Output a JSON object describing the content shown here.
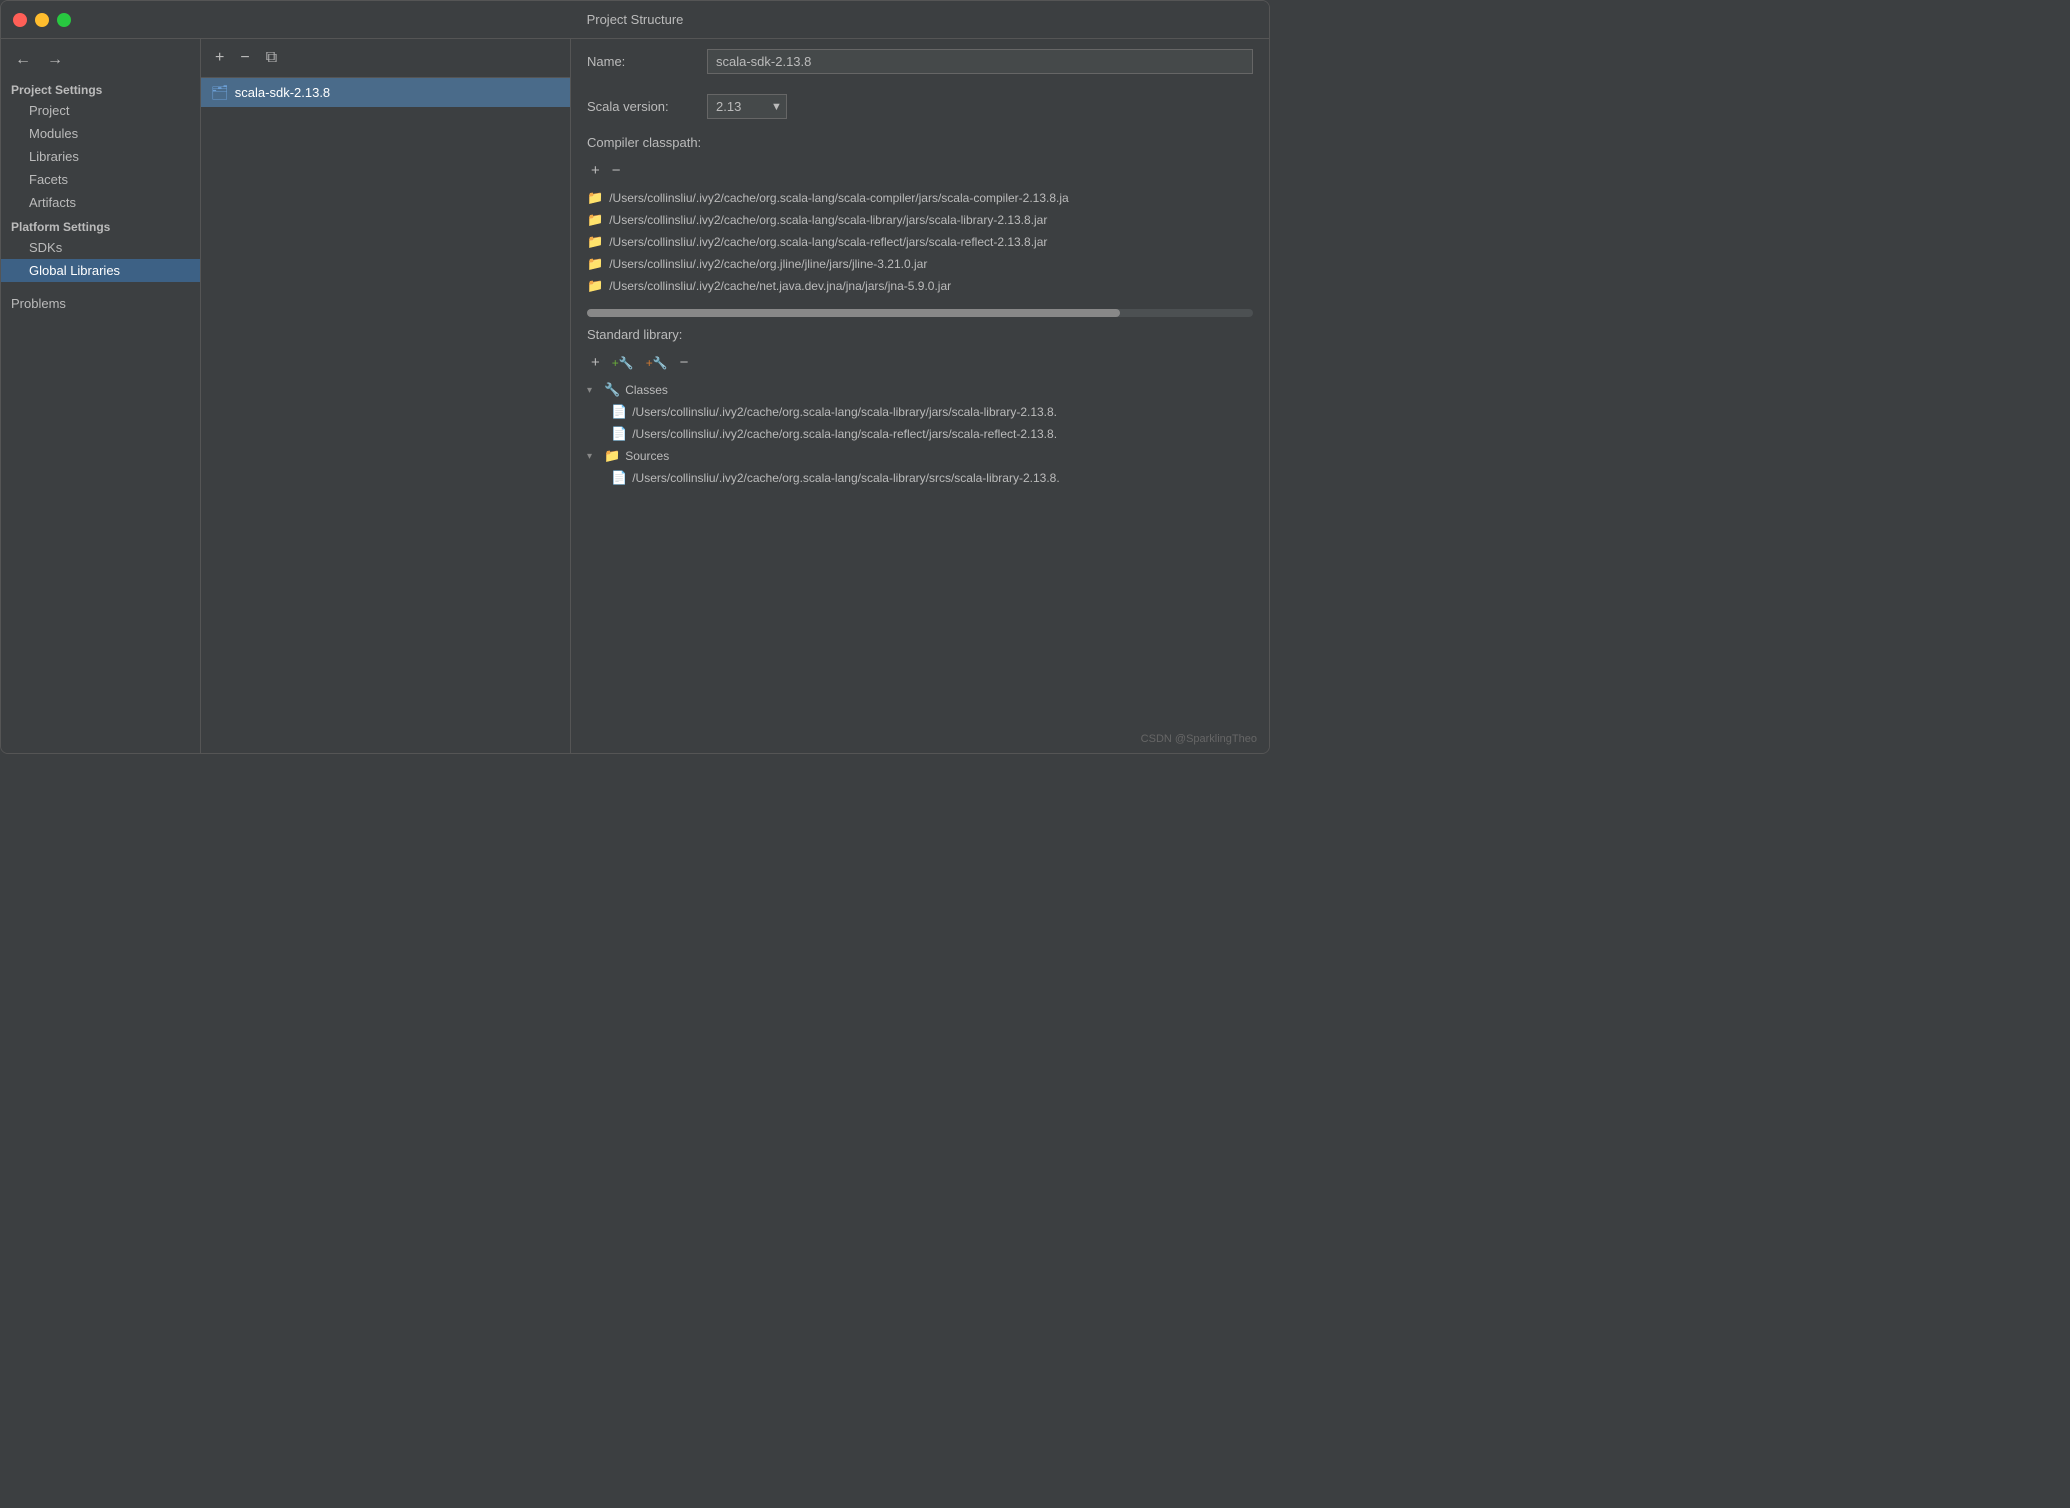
{
  "window": {
    "title": "Project Structure"
  },
  "sidebar": {
    "nav": {
      "back_label": "←",
      "forward_label": "→"
    },
    "project_settings_label": "Project Settings",
    "items": [
      {
        "id": "project",
        "label": "Project",
        "active": false
      },
      {
        "id": "modules",
        "label": "Modules",
        "active": false
      },
      {
        "id": "libraries",
        "label": "Libraries",
        "active": false
      },
      {
        "id": "facets",
        "label": "Facets",
        "active": false
      },
      {
        "id": "artifacts",
        "label": "Artifacts",
        "active": false
      }
    ],
    "platform_settings_label": "Platform Settings",
    "platform_items": [
      {
        "id": "sdks",
        "label": "SDKs",
        "active": false
      },
      {
        "id": "global-libraries",
        "label": "Global Libraries",
        "active": true
      }
    ],
    "problems_label": "Problems"
  },
  "center": {
    "add_btn": "+",
    "remove_btn": "−",
    "copy_btn": "⧉",
    "sdk_name": "scala-sdk-2.13.8"
  },
  "right": {
    "name_label": "Name:",
    "name_value": "scala-sdk-2.13.8",
    "scala_version_label": "Scala version:",
    "scala_version_value": "2.13",
    "compiler_classpath_label": "Compiler classpath:",
    "add_btn": "+",
    "minus_btn": "−",
    "classpath_items": [
      "/Users/collinsliu/.ivy2/cache/org.scala-lang/scala-compiler/jars/scala-compiler-2.13.8.ja",
      "/Users/collinsliu/.ivy2/cache/org.scala-lang/scala-library/jars/scala-library-2.13.8.jar",
      "/Users/collinsliu/.ivy2/cache/org.scala-lang/scala-reflect/jars/scala-reflect-2.13.8.jar",
      "/Users/collinsliu/.ivy2/cache/org.jline/jline/jars/jline-3.21.0.jar",
      "/Users/collinsliu/.ivy2/cache/net.java.dev.jna/jna/jars/jna-5.9.0.jar"
    ],
    "standard_library_label": "Standard library:",
    "stdlib_add_btn": "+",
    "stdlib_add2_btn": "+▲",
    "stdlib_add3_btn": "+▼",
    "stdlib_minus_btn": "−",
    "tree": {
      "classes_label": "Classes",
      "classes_items": [
        "/Users/collinsliu/.ivy2/cache/org.scala-lang/scala-library/jars/scala-library-2.13.8.",
        "/Users/collinsliu/.ivy2/cache/org.scala-lang/scala-reflect/jars/scala-reflect-2.13.8."
      ],
      "sources_label": "Sources",
      "sources_items": [
        "/Users/collinsliu/.ivy2/cache/org.scala-lang/scala-library/srcs/scala-library-2.13.8."
      ]
    }
  },
  "watermark": "CSDN @SparklingTheo"
}
